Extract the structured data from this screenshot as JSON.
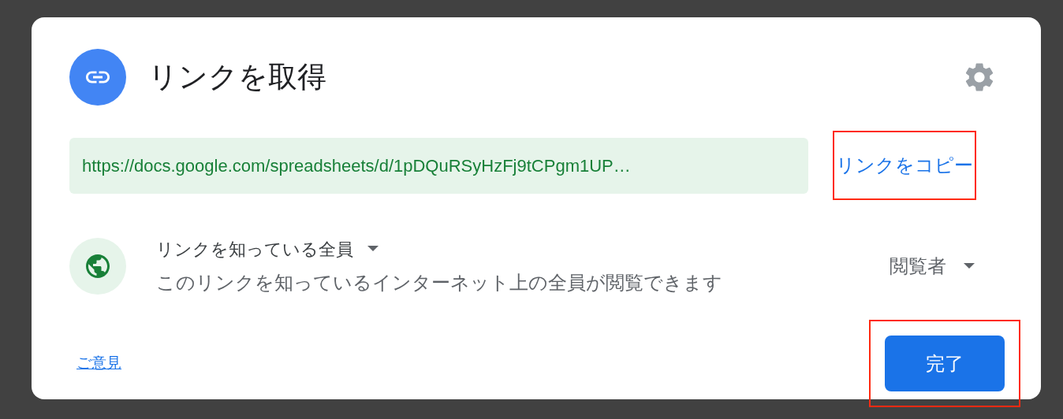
{
  "dialog": {
    "title": "リンクを取得",
    "link": {
      "url": "https://docs.google.com/spreadsheets/d/1pDQuRSyHzFj9tCPgm1UP…"
    },
    "copy_link": {
      "label": "リンクをコピー",
      "highlighted": true
    },
    "access": {
      "scope": "リンクを知っている全員",
      "description": "このリンクを知っているインターネット上の全員が閲覧できます",
      "role": "閲覧者"
    },
    "feedback": "ご意見",
    "done": {
      "label": "完了",
      "highlighted": true
    }
  }
}
